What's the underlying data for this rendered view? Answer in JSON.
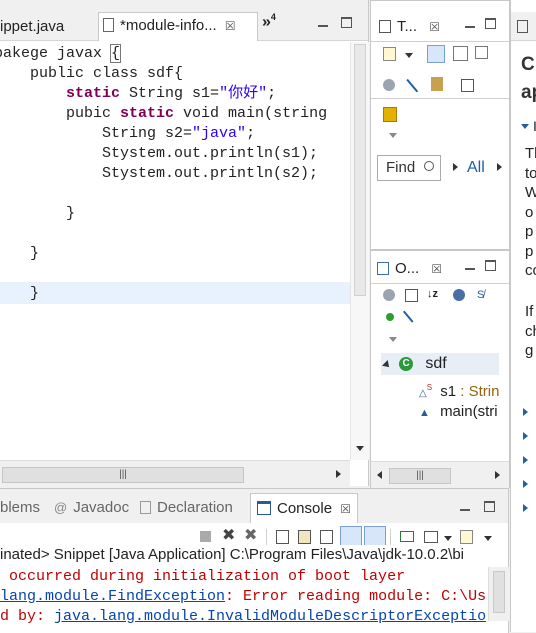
{
  "editor": {
    "tabs": [
      {
        "label": "ippet.java"
      },
      {
        "label": "*module-info...",
        "close": "☒"
      }
    ],
    "overflow": "»",
    "overflow_count": "4",
    "code": [
      {
        "parts": [
          {
            "t": "pakege javax "
          },
          {
            "t": "{",
            "cls": "bracket"
          }
        ]
      },
      {
        "parts": [
          {
            "t": "    public class sdf{"
          }
        ]
      },
      {
        "parts": [
          {
            "t": "        "
          },
          {
            "t": "static",
            "cls": "kw"
          },
          {
            "t": " String s1="
          },
          {
            "t": "\"你好\"",
            "cls": "str"
          },
          {
            "t": ";"
          }
        ]
      },
      {
        "parts": [
          {
            "t": "        pubic "
          },
          {
            "t": "static",
            "cls": "kw"
          },
          {
            "t": " void main(string"
          }
        ]
      },
      {
        "parts": [
          {
            "t": "            String s2="
          },
          {
            "t": "\"java\"",
            "cls": "str"
          },
          {
            "t": ";"
          }
        ]
      },
      {
        "parts": [
          {
            "t": "            Stystem.out.println(s1);"
          }
        ]
      },
      {
        "parts": [
          {
            "t": "            Stystem.out.println(s2);"
          }
        ]
      },
      {
        "parts": [
          {
            "t": ""
          }
        ]
      },
      {
        "parts": [
          {
            "t": "        }"
          }
        ]
      },
      {
        "parts": [
          {
            "t": ""
          }
        ]
      },
      {
        "parts": [
          {
            "t": "    }"
          }
        ]
      },
      {
        "parts": [
          {
            "t": ""
          }
        ]
      },
      {
        "parts": [
          {
            "t": "    }"
          }
        ]
      }
    ],
    "hscroll_grip": "|||"
  },
  "tasklist": {
    "title": "T...",
    "close": "☒",
    "find_placeholder": "Find",
    "all_label": "All"
  },
  "outline": {
    "title": "O...",
    "close": "☒",
    "class_name": "sdf",
    "members": [
      {
        "name": "s1",
        "type": " : Strin"
      },
      {
        "name": "main(stri",
        "type": ""
      }
    ],
    "hscroll_grip": "|||"
  },
  "help": {
    "title": "Cr",
    "subtitle": "ap",
    "para1": [
      "Th",
      "to",
      "W",
      "o",
      "p",
      "p",
      "co"
    ],
    "para2": [
      "If",
      "ch",
      "g"
    ]
  },
  "console_panel": {
    "tabs": [
      {
        "label": "blems"
      },
      {
        "label": "Javadoc",
        "prefix": "@"
      },
      {
        "label": "Declaration"
      },
      {
        "label": "Console",
        "close": "☒"
      }
    ],
    "header": "inated> Snippet [Java Application] C:\\Program Files\\Java\\jdk-10.0.2\\bi",
    "lines": [
      {
        "parts": [
          {
            "t": " occurred during initialization of boot layer"
          }
        ]
      },
      {
        "parts": [
          {
            "t": "lang.module.FindException",
            "cls": "lnk"
          },
          {
            "t": ": Error reading module: C:\\Us"
          }
        ]
      },
      {
        "parts": [
          {
            "t": "d by: "
          },
          {
            "t": "java.lang.module.InvalidModuleDescriptorExceptio",
            "cls": "lnk"
          }
        ]
      }
    ]
  },
  "colors": {
    "keyword": "#7f0055",
    "string": "#2a00ff",
    "link": "#0645ad",
    "current_line": "#e8f2fe",
    "tab_active": "#ffffff"
  }
}
